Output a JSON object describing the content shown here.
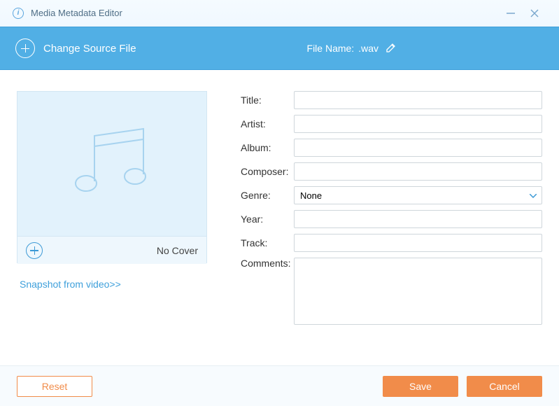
{
  "titlebar": {
    "title": "Media Metadata Editor"
  },
  "toolbar": {
    "change_source": "Change Source File",
    "file_name_label": "File Name:",
    "file_name_value": ".wav"
  },
  "cover": {
    "no_cover": "No Cover",
    "snapshot_link": "Snapshot from video>>"
  },
  "form": {
    "labels": {
      "title": "Title:",
      "artist": "Artist:",
      "album": "Album:",
      "composer": "Composer:",
      "genre": "Genre:",
      "year": "Year:",
      "track": "Track:",
      "comments": "Comments:"
    },
    "values": {
      "title": "",
      "artist": "",
      "album": "",
      "composer": "",
      "genre": "None",
      "year": "",
      "track": "",
      "comments": ""
    }
  },
  "footer": {
    "reset": "Reset",
    "save": "Save",
    "cancel": "Cancel"
  }
}
